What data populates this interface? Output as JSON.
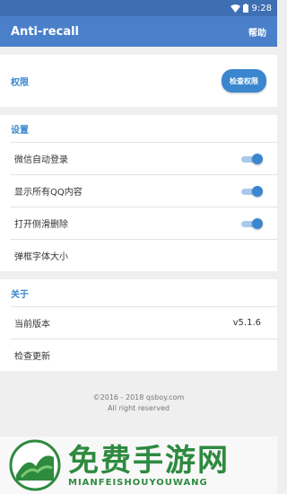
{
  "status_bar": {
    "time": "9:28"
  },
  "app_bar": {
    "title": "Anti-recall",
    "help_label": "帮助"
  },
  "permission": {
    "section_title": "权限",
    "check_button": "检查权限"
  },
  "settings": {
    "section_title": "设置",
    "items": [
      {
        "label": "微信自动登录",
        "toggle_on": true
      },
      {
        "label": "显示所有QQ内容",
        "toggle_on": true
      },
      {
        "label": "打开侧滑删除",
        "toggle_on": true
      },
      {
        "label": "弹框字体大小"
      }
    ]
  },
  "about": {
    "section_title": "关于",
    "version_label": "当前版本",
    "version_value": "v5.1.6",
    "check_update_label": "检查更新"
  },
  "footer": {
    "copyright": "©2016 - 2018 qsboy.com",
    "rights": "All right reserved"
  },
  "watermark": {
    "title": "免费手游网",
    "subtitle": "MIANFEISHOUYOUWANG",
    "color": "#2e8a3f"
  },
  "colors": {
    "app_bar": "#4a80c9",
    "accent": "#3a86cf"
  }
}
